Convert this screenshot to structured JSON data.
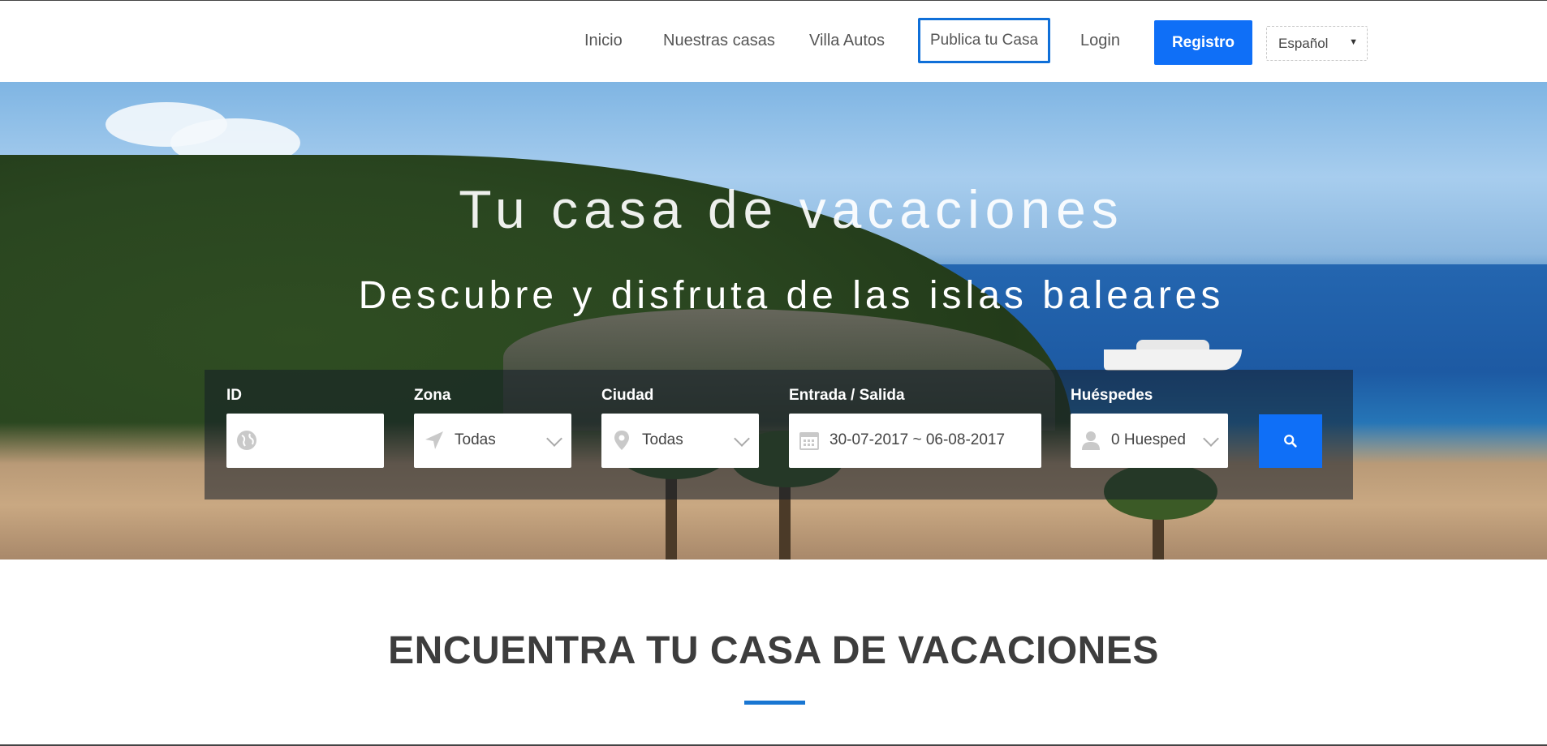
{
  "nav": {
    "links": [
      "Inicio",
      "Nuestras casas",
      "Villa Autos"
    ],
    "publish_label": "Publica tu Casa",
    "login_label": "Login",
    "register_label": "Registro",
    "language": "Español"
  },
  "hero": {
    "title": "Tu casa de vacaciones",
    "subtitle": "Descubre y disfruta de las islas baleares"
  },
  "search": {
    "id_label": "ID",
    "id_value": "",
    "zona_label": "Zona",
    "zona_value": "Todas",
    "ciudad_label": "Ciudad",
    "ciudad_value": "Todas",
    "dates_label": "Entrada / Salida",
    "dates_value": "30-07-2017 ~ 06-08-2017",
    "guests_label": "Huéspedes",
    "guests_value": "0 Huesped"
  },
  "section": {
    "title": "ENCUENTRA TU CASA DE VACACIONES"
  },
  "colors": {
    "accent": "#0f6ff7",
    "underline": "#1976d2",
    "title": "#3d3d3d"
  },
  "icons": {
    "id_field": "globe-icon",
    "zona_field": "location-arrow-icon",
    "ciudad_field": "map-marker-icon",
    "dates_field": "calendar-icon",
    "guests_field": "user-icon",
    "search_button": "search-icon"
  }
}
